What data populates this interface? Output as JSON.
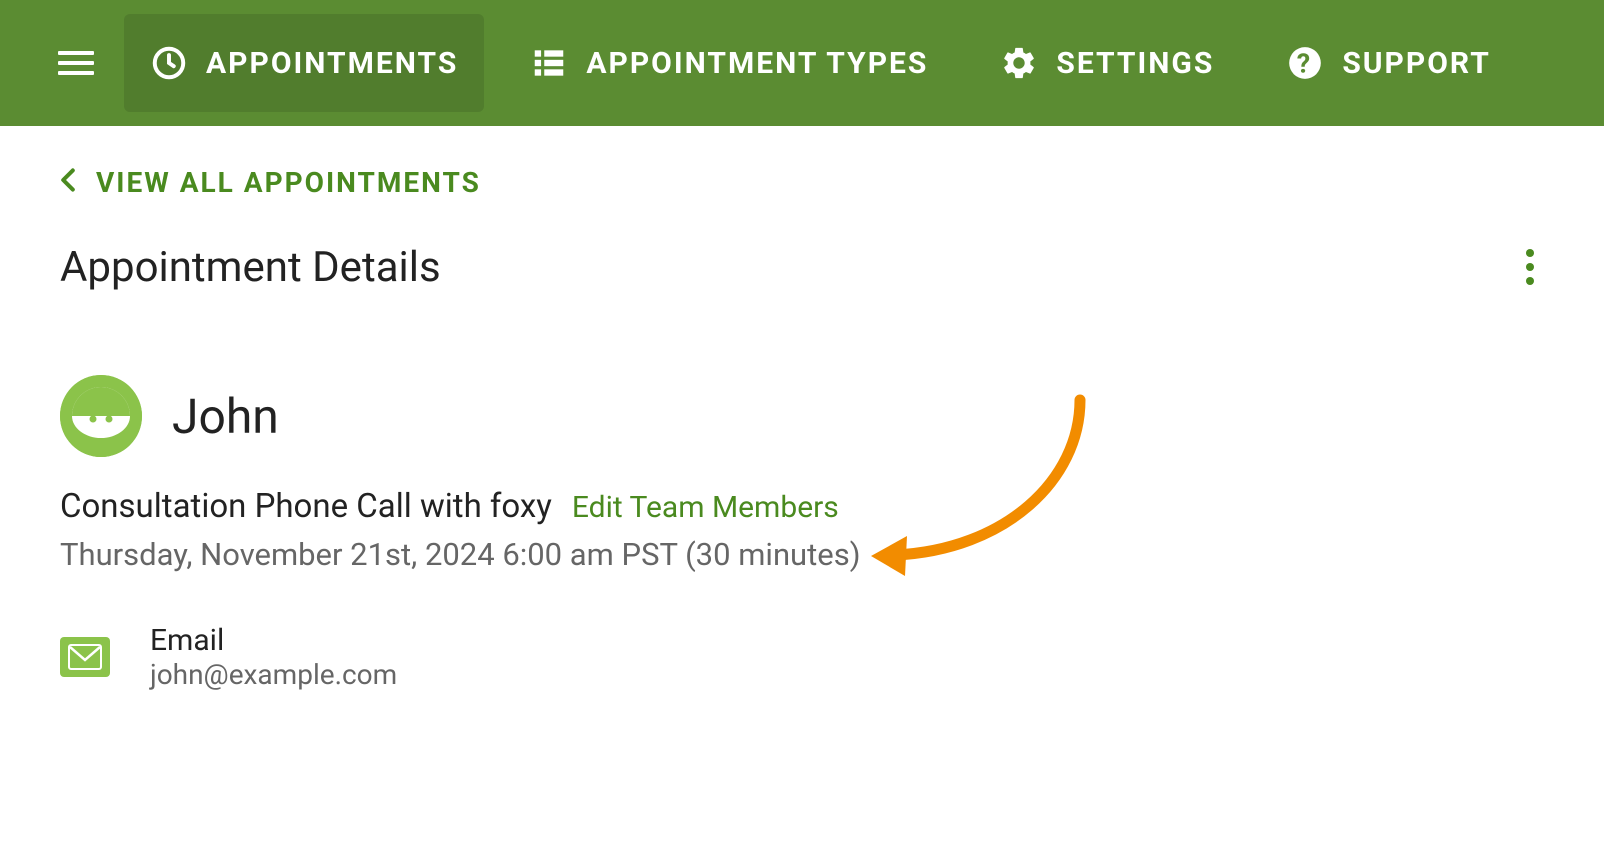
{
  "nav": {
    "appointments": "APPOINTMENTS",
    "appointment_types": "APPOINTMENT TYPES",
    "settings": "SETTINGS",
    "support": "SUPPORT"
  },
  "back_link": "VIEW ALL APPOINTMENTS",
  "page_title": "Appointment Details",
  "user": {
    "name": "John"
  },
  "appointment": {
    "title": "Consultation Phone Call with foxy",
    "edit_link": "Edit Team Members",
    "datetime": "Thursday, November 21st, 2024 6:00 am PST (30 minutes)"
  },
  "contact": {
    "email_label": "Email",
    "email_value": "john@example.com"
  }
}
